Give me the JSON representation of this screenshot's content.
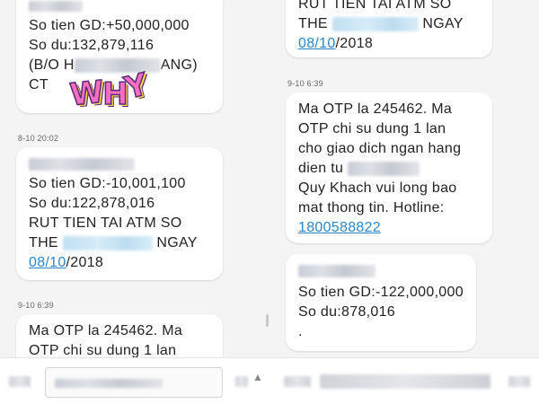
{
  "left_pane": {
    "msg1": {
      "balance_change": "So tien GD:+50,000,000",
      "balance": "So du:132,879,116",
      "desc_prefix": "(B/O H",
      "desc_suffix": "ANG)",
      "desc_line2": "CT"
    },
    "sticker": {
      "letters": [
        "W",
        "H",
        "Y"
      ]
    },
    "ts2": "8-10 20:02",
    "msg2": {
      "balance_change": "So tien GD:-10,001,100",
      "balance": "So du:122,878,016",
      "line3": "RUT TIEN TAI ATM SO",
      "line4_prefix": "THE",
      "line4_suffix": "NGAY",
      "date_link": "08/10",
      "date_rest": "/2018"
    },
    "ts3": "9-10 6:39",
    "msg3": {
      "line1": "Ma OTP la 245462. Ma",
      "line2": "OTP chi su dung 1 lan"
    }
  },
  "right_pane": {
    "msg1": {
      "line1": "RUT TIEN TAI ATM SO",
      "line2_prefix": "THE",
      "line2_suffix": "NGAY",
      "date_link": "08/10",
      "date_rest": "/2018"
    },
    "ts2": "9-10 6:39",
    "msg2": {
      "line1": "Ma OTP la 245462. Ma",
      "line2": "OTP chi su dung 1 lan",
      "line3": "cho giao dich ngan hang",
      "line4": "dien tu",
      "line5": "Quy Khach vui long bao",
      "line6": "mat thong tin. Hotline:",
      "hotline": "1800588822"
    },
    "msg3": {
      "balance_change": "So tien GD:-122,000,000",
      "balance": "So du:878,016",
      "line3": "."
    }
  },
  "icons": {
    "composer_chevron": "chevron-up-icon"
  }
}
